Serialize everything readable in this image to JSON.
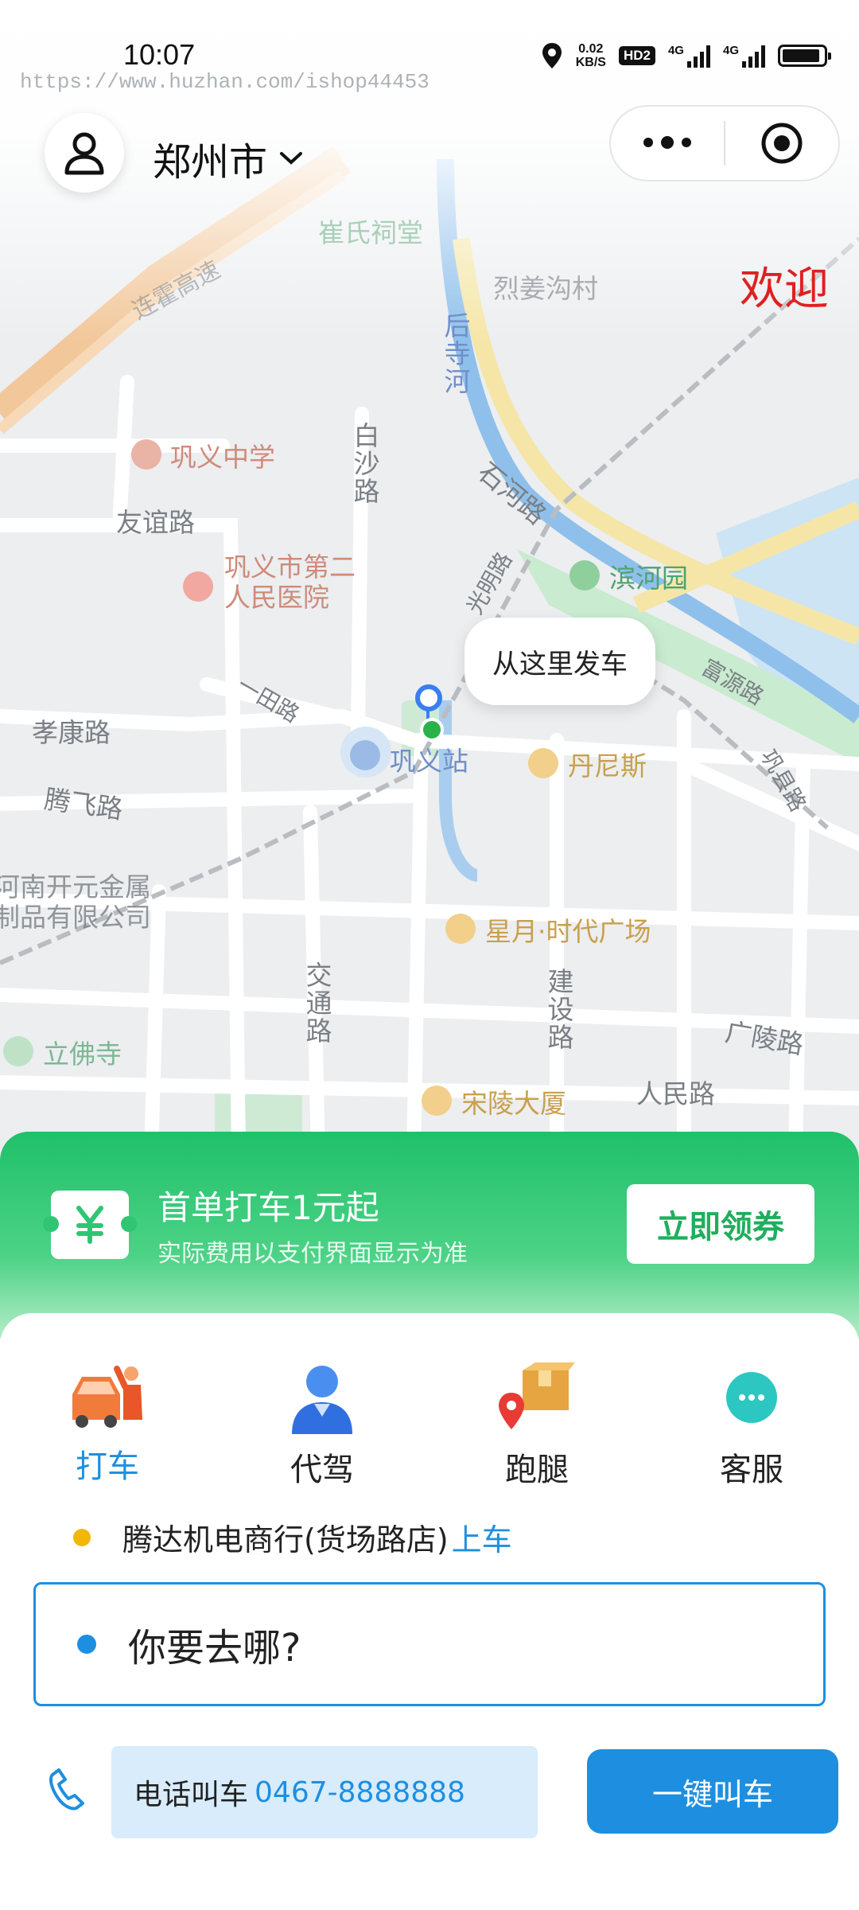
{
  "status_bar": {
    "time": "10:07",
    "watermark": "https://www.huzhan.com/ishop44453",
    "net_speed_value": "0.02",
    "net_speed_unit": "KB/S",
    "hd_badge": "HD2",
    "signal_1_label": "4G",
    "signal_2_label": "4G",
    "icons": [
      "location-icon",
      "battery-icon"
    ]
  },
  "header": {
    "city": "郑州市",
    "avatar_icon": "user-icon",
    "more_icon": "more-dots-icon",
    "close_icon": "target-icon"
  },
  "map": {
    "welcome_text": "欢迎",
    "labels": {
      "cuishi": "崔氏祠堂",
      "liejiang": "烈姜沟村",
      "houshi_river": "后寺河",
      "gongyi_middle": "巩义中学",
      "baisha_road": "白沙路",
      "youyi_road": "友谊路",
      "shihe_road": "石河路",
      "binhe_park": "滨河园",
      "hospital": "巩义市第二人民医院",
      "guangming_road": "光明路",
      "yitian_road": "一田路",
      "xiaokang_road": "孝康路",
      "gongyi_station": "巩义站",
      "danisi": "丹尼斯",
      "tengfei_road": "腾飞路",
      "kaiyuan_metal": "河南开元金属制品有限公司",
      "xingyue_plaza": "星月·时代广场",
      "jiaotong_road": "交通路",
      "jianshe_road": "建设路",
      "guangling_road": "广陵路",
      "lifo_temple": "立佛寺",
      "songling_tower": "宋陵大厦",
      "renmin_road": "人民路",
      "fuyuan_road": "富源路",
      "gongxian_road": "巩县路",
      "expressway": "连霍高速"
    },
    "bubble_text": "从这里发车"
  },
  "promo": {
    "icon": "yuan-ticket-icon",
    "title": "首单打车1元起",
    "subtitle": "实际费用以支付界面显示为准",
    "button": "立即领券"
  },
  "services": [
    {
      "label": "打车",
      "icon": "taxi-icon",
      "active": true
    },
    {
      "label": "代驾",
      "icon": "driver-icon",
      "active": false
    },
    {
      "label": "跑腿",
      "icon": "delivery-icon",
      "active": false
    },
    {
      "label": "客服",
      "icon": "chat-icon",
      "active": false
    }
  ],
  "pickup": {
    "address": "腾达机电商行(货场路店)",
    "tag": "上车"
  },
  "destination": {
    "placeholder": "你要去哪?"
  },
  "phone_call": {
    "icon": "phone-icon",
    "label": "电话叫车",
    "number": "0467-8888888",
    "button": "一键叫车"
  },
  "colors": {
    "accent_blue": "#1e8fe0",
    "promo_green": "#20c06a",
    "pickup_yellow": "#f2b705",
    "welcome_red": "#e02020"
  }
}
